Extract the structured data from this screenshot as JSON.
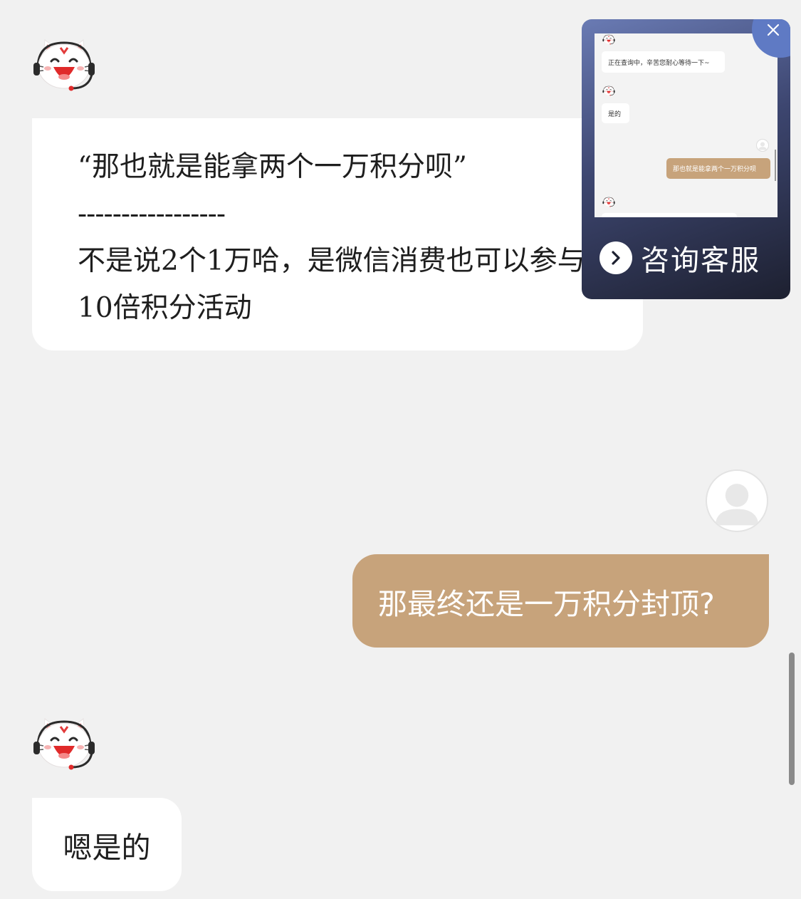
{
  "conversation": {
    "messages": [
      {
        "sender": "agent",
        "quote": "“那也就是能拿两个一万积分呗”",
        "separator": "-----------------",
        "reply_line1": "不是说2个1万哈，是微信消费也可以参与",
        "reply_line2": "10倍积分活动"
      },
      {
        "sender": "user",
        "text": "那最终还是一万积分封顶?"
      },
      {
        "sender": "agent",
        "text": "嗯是的"
      }
    ]
  },
  "floating_widget": {
    "cta_label": "咨询客服",
    "preview": {
      "msg1": "正在查询中，辛苦您耐心等待一下~",
      "msg2": "是的",
      "msg3": "那也就是能拿两个一万积分呗"
    }
  },
  "icons": {
    "agent_avatar": "cat-agent-avatar-icon",
    "user_avatar": "default-user-avatar-icon",
    "close": "close-icon",
    "cta_arrow": "chevron-right-icon"
  },
  "colors": {
    "background": "#f1f1f1",
    "agent_bubble": "#ffffff",
    "user_bubble": "#c7a37b",
    "widget_gradient_top": "#6a7bb4",
    "widget_gradient_bottom": "#1d2030",
    "close_button": "#5f7ac4"
  }
}
